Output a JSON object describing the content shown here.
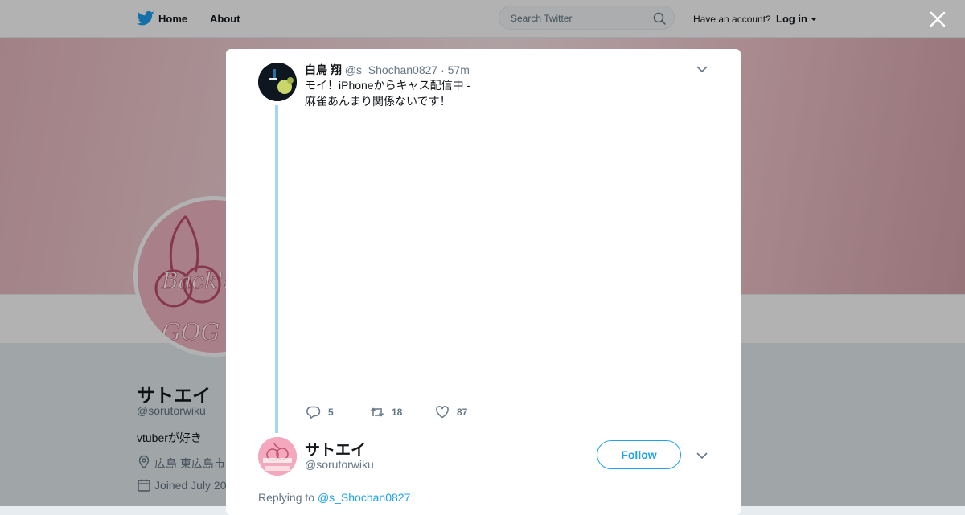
{
  "topbar": {
    "home_label": "Home",
    "about_label": "About",
    "search_placeholder": "Search Twitter",
    "have_account": "Have an account?",
    "login_label": "Log in"
  },
  "profile": {
    "name": "サトエイ",
    "handle": "@sorutorwiku",
    "bio": "vtuberが好き",
    "location": "広島 東広島市",
    "joined": "Joined July 20",
    "avatar_text_1": "Back's",
    "avatar_text_2": "GOG"
  },
  "tweet": {
    "author_name": "白鳥 翔",
    "author_handle": "@s_Shochan0827",
    "separator": "·",
    "time": "57m",
    "text_line1": "モイ！iPhoneからキャス配信中 -",
    "text_line2": "麻雀あんまり関係ないです！",
    "replies": "5",
    "retweets": "18",
    "likes": "87"
  },
  "reply": {
    "author_name": "サトエイ",
    "author_handle": "@sorutorwiku",
    "follow_label": "Follow",
    "replying_prefix": "Replying to",
    "replying_to": "@s_Shochan0827"
  },
  "colors": {
    "accent": "#1da1f2",
    "thread_line": "#a3d7f5",
    "muted_text": "#657786",
    "primary_text": "#14171a"
  },
  "icons": [
    "twitter-bird-icon",
    "search-icon",
    "caret-down-icon",
    "close-icon",
    "chevron-down-icon",
    "reply-icon",
    "retweet-icon",
    "heart-icon",
    "location-icon",
    "calendar-icon"
  ]
}
